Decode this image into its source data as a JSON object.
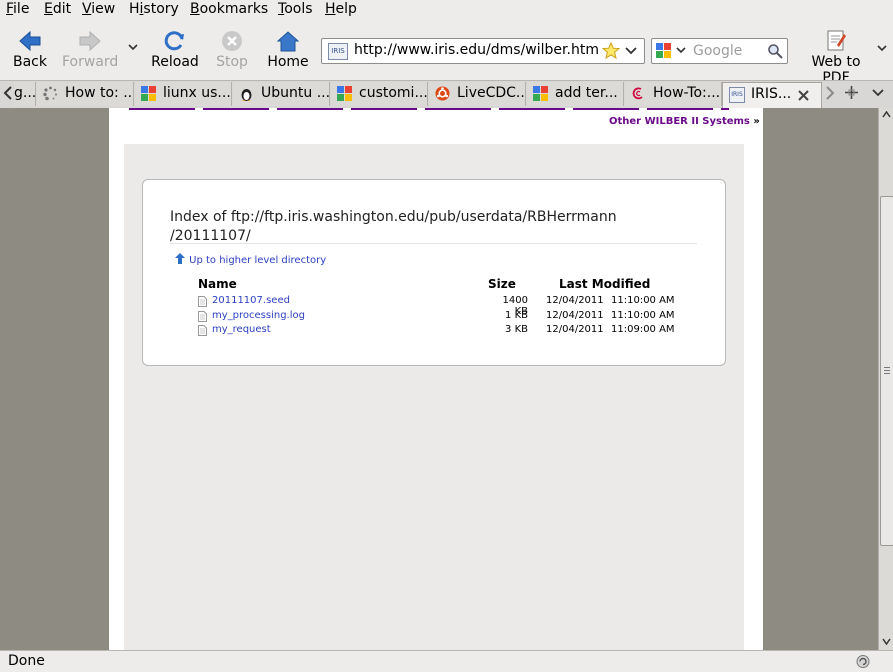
{
  "menubar": {
    "items": [
      {
        "first": "F",
        "rest": "ile"
      },
      {
        "first": "E",
        "rest": "dit"
      },
      {
        "first": "V",
        "rest": "iew"
      },
      {
        "first": "H",
        "rest": "istory",
        "prefix": ""
      },
      {
        "first": "B",
        "rest": "ookmarks"
      },
      {
        "first": "T",
        "rest": "ools"
      },
      {
        "first": "H",
        "rest": "elp"
      }
    ],
    "history_label": "History"
  },
  "toolbar": {
    "back_label": "Back",
    "forward_label": "Forward",
    "reload_label": "Reload",
    "stop_label": "Stop",
    "home_label": "Home",
    "webtopdf_label": "Web to PDF",
    "url": "http://www.iris.edu/dms/wilber.htm",
    "search_placeholder": "Google",
    "site_favicon_text": "IRIS"
  },
  "tabs": [
    {
      "label": "How to: ...",
      "icon": "loading-icon"
    },
    {
      "label": "liunx us...",
      "icon": "google-icon"
    },
    {
      "label": "Ubuntu ...",
      "icon": "tux-icon"
    },
    {
      "label": "customi...",
      "icon": "google-icon"
    },
    {
      "label": "LiveCDC...",
      "icon": "ubuntu-icon"
    },
    {
      "label": "add ter...",
      "icon": "google-icon"
    },
    {
      "label": "How-To:...",
      "icon": "debian-icon"
    },
    {
      "label": "IRIS...",
      "icon": "iris-icon"
    }
  ],
  "tab_first_partial": "g...",
  "page": {
    "other_systems_link": "Other WILBER II Systems",
    "other_systems_arrow": "»",
    "index_title_line1": "Index of ftp://ftp.iris.washington.edu/pub/userdata/RBHerrmann",
    "index_title_line2": "/20111107/",
    "up_link": "Up to higher level directory",
    "headers": {
      "name": "Name",
      "size": "Size",
      "modified": "Last Modified"
    },
    "files": [
      {
        "name": "20111107.seed",
        "size": "1400 KB",
        "date": "12/04/2011",
        "time": "11:10:00 AM"
      },
      {
        "name": "my_processing.log",
        "size": "1 KB",
        "date": "12/04/2011",
        "time": "11:10:00 AM"
      },
      {
        "name": "my_request",
        "size": "3 KB",
        "date": "12/04/2011",
        "time": "11:09:00 AM"
      }
    ]
  },
  "status": {
    "text": "Done"
  },
  "colors": {
    "link": "#2b3fc2",
    "visited_link": "#6b0b8a",
    "accent_blue": "#2d6fc4"
  }
}
